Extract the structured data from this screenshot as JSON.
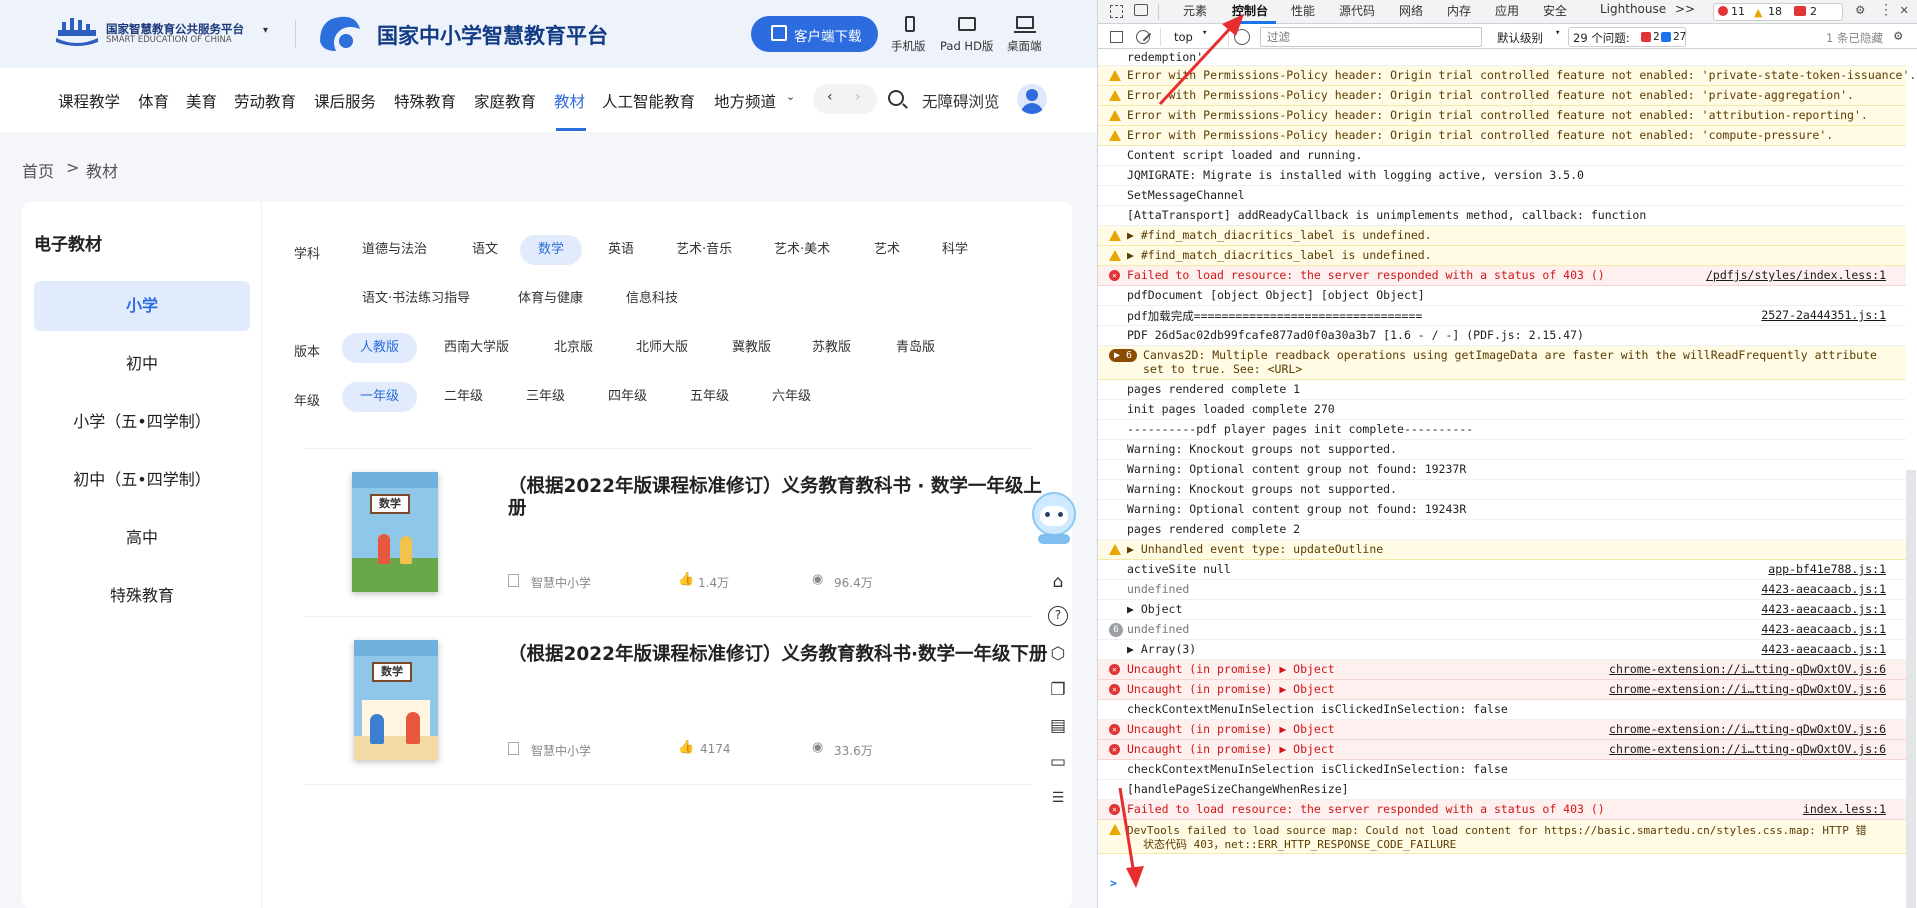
{
  "site": {
    "logo1_cn": "国家智慧教育公共服务平台",
    "logo1_en": "SMART EDUCATION OF CHINA",
    "logo2": "国家中小学智慧教育平台",
    "download_btn": "客户端下载",
    "devices": [
      "手机版",
      "Pad HD版",
      "桌面端"
    ],
    "nav": [
      "课程教学",
      "体育",
      "美育",
      "劳动教育",
      "课后服务",
      "特殊教育",
      "家庭教育",
      "教材",
      "人工智能教育",
      "地方频道"
    ],
    "nav_active": "教材",
    "accessibility": "无障碍浏览",
    "breadcrumb": {
      "home": "首页",
      "sep": ">",
      "current": "教材"
    },
    "sidebar": {
      "title": "电子教材",
      "items": [
        "小学",
        "初中",
        "小学（五•四学制）",
        "初中（五•四学制）",
        "高中",
        "特殊教育"
      ],
      "active": "小学"
    },
    "filters": {
      "subject_label": "学科",
      "subjects_row1": [
        "道德与法治",
        "语文",
        "数学",
        "英语",
        "艺术·音乐",
        "艺术·美术",
        "艺术",
        "科学"
      ],
      "subjects_row2": [
        "语文·书法练习指导",
        "体育与健康",
        "信息科技"
      ],
      "subject_active": "数学",
      "version_label": "版本",
      "versions": [
        "人教版",
        "西南大学版",
        "北京版",
        "北师大版",
        "冀教版",
        "苏教版",
        "青岛版"
      ],
      "version_active": "人教版",
      "grade_label": "年级",
      "grades": [
        "一年级",
        "二年级",
        "三年级",
        "四年级",
        "五年级",
        "六年级"
      ],
      "grade_active": "一年级"
    },
    "books": [
      {
        "title": "（根据2022年版课程标准修订）义务教育教科书 · 数学一年级上册",
        "publisher": "智慧中小学",
        "likes": "1.4万",
        "views": "96.4万",
        "cover_label": "数学"
      },
      {
        "title": "（根据2022年版课程标准修订）义务教育教科书·数学一年级下册",
        "publisher": "智慧中小学",
        "likes": "4174",
        "views": "33.6万",
        "cover_label": "数学"
      }
    ]
  },
  "devtools": {
    "tabs": [
      "元素",
      "控制台",
      "性能",
      "源代码",
      "网络",
      "内存",
      "应用",
      "安全",
      "Lighthouse"
    ],
    "active_tab": "控制台",
    "more": ">>",
    "counts": {
      "errors": "11",
      "warnings": "18",
      "issues_err": "2"
    },
    "context": "top",
    "filter_placeholder": "过滤",
    "level": "默认级别",
    "issues_label": "29 个问题:",
    "issues_err": "2",
    "issues_info": "27",
    "hidden": "1 条已隐藏",
    "rows": [
      {
        "type": "plain",
        "msg": "redemption'"
      },
      {
        "type": "warn",
        "msg": "Error with Permissions-Policy header: Origin trial controlled feature not enabled: 'private-state-token-issuance'."
      },
      {
        "type": "warn",
        "msg": "Error with Permissions-Policy header: Origin trial controlled feature not enabled: 'private-aggregation'."
      },
      {
        "type": "warn",
        "msg": "Error with Permissions-Policy header: Origin trial controlled feature not enabled: 'attribution-reporting'."
      },
      {
        "type": "warn",
        "msg": "Error with Permissions-Policy header: Origin trial controlled feature not enabled: 'compute-pressure'."
      },
      {
        "type": "plain",
        "msg": "Content script loaded and running."
      },
      {
        "type": "plain",
        "msg": "JQMIGRATE: Migrate is installed with logging active, version 3.5.0"
      },
      {
        "type": "plain",
        "msg": "SetMessageChannel"
      },
      {
        "type": "plain",
        "msg": "[AttaTransport] addReadyCallback is unimplements method, callback: function"
      },
      {
        "type": "warn",
        "msg": "▶ #find_match_diacritics_label is undefined."
      },
      {
        "type": "warn",
        "msg": "▶ #find_match_diacritics_label is undefined."
      },
      {
        "type": "err",
        "msg": "Failed to load resource: the server responded with a status of 403 ()",
        "src": "/pdfjs/styles/index.less:1"
      },
      {
        "type": "plain",
        "msg": "pdfDocument [object Object] [object Object]"
      },
      {
        "type": "plain",
        "msg": "pdf加载完成=================================",
        "src": "2527-2a444351.js:1"
      },
      {
        "type": "plain",
        "msg": "PDF 26d5ac02db99fcafe877ad0f0a30a3b7 [1.6 - / -] (PDF.js: 2.15.47)"
      },
      {
        "type": "warn2",
        "badge": "▶ 6",
        "msg": "Canvas2D: Multiple readback operations using getImageData are faster with the willReadFrequently attribute",
        "msg2": "set to true. See: <URL>"
      },
      {
        "type": "plain",
        "msg": "pages rendered complete 1"
      },
      {
        "type": "plain",
        "msg": "init pages loaded complete 270"
      },
      {
        "type": "plain",
        "msg": "----------pdf player pages init complete----------"
      },
      {
        "type": "plain",
        "msg": "Warning: Knockout groups not supported."
      },
      {
        "type": "plain",
        "msg": "Warning: Optional content group not found: 19237R"
      },
      {
        "type": "plain",
        "msg": "Warning: Knockout groups not supported."
      },
      {
        "type": "plain",
        "msg": "Warning: Optional content group not found: 19243R"
      },
      {
        "type": "plain",
        "msg": "pages rendered complete 2"
      },
      {
        "type": "warn",
        "msg": "▶ Unhandled event type: updateOutline"
      },
      {
        "type": "plain",
        "msg": "activeSite null",
        "src": "app-bf41e788.js:1"
      },
      {
        "type": "plain",
        "msg": "undefined",
        "src": "4423-aeacaacb.js:1",
        "grey": true
      },
      {
        "type": "plain",
        "msg": "▶ Object",
        "src": "4423-aeacaacb.js:1"
      },
      {
        "type": "badge",
        "badge": "6",
        "msg": "undefined",
        "src": "4423-aeacaacb.js:1",
        "grey": true
      },
      {
        "type": "plain",
        "msg": "▶ Array(3)",
        "src": "4423-aeacaacb.js:1"
      },
      {
        "type": "err",
        "msg": "Uncaught (in promise)  ▶ Object",
        "src": "chrome-extension://i…tting-qDwOxtOV.js:6"
      },
      {
        "type": "err",
        "msg": "Uncaught (in promise)  ▶ Object",
        "src": "chrome-extension://i…tting-qDwOxtOV.js:6"
      },
      {
        "type": "plain",
        "msg": "checkContextMenuInSelection isClickedInSelection:  false"
      },
      {
        "type": "err",
        "msg": "Uncaught (in promise)  ▶ Object",
        "src": "chrome-extension://i…tting-qDwOxtOV.js:6"
      },
      {
        "type": "err",
        "msg": "Uncaught (in promise)  ▶ Object",
        "src": "chrome-extension://i…tting-qDwOxtOV.js:6"
      },
      {
        "type": "plain",
        "msg": "checkContextMenuInSelection isClickedInSelection:  false"
      },
      {
        "type": "plain",
        "msg": "[handlePageSizeChangeWhenResize]"
      },
      {
        "type": "err",
        "msg": "Failed to load resource: the server responded with a status of 403 ()",
        "src": "index.less:1"
      },
      {
        "type": "warn2",
        "msg": "DevTools failed to load source map: Could not load content for https://basic.smartedu.cn/styles.css.map: HTTP 错",
        "msg2": "状态代码 403，net::ERR_HTTP_RESPONSE_CODE_FAILURE"
      }
    ],
    "prompt": ">"
  }
}
